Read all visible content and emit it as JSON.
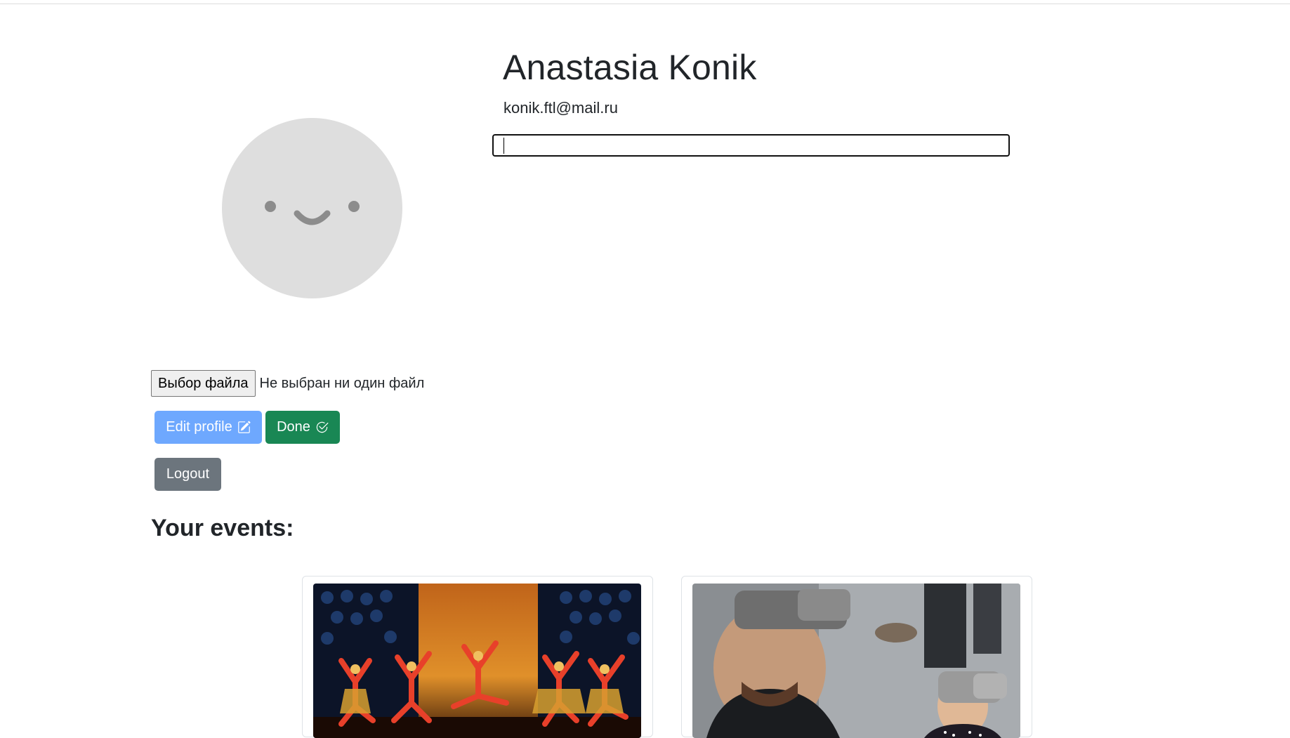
{
  "profile": {
    "name": "Anastasia Konik",
    "email": "konik.ftl@mail.ru",
    "bio_value": "",
    "avatar_icon": "smiley-placeholder-icon"
  },
  "file_input": {
    "button_label": "Выбор файла",
    "status_text": "Не выбран ни один файл"
  },
  "actions": {
    "edit_label": "Edit profile",
    "edit_icon": "pencil-square-icon",
    "done_label": "Done",
    "done_icon": "check-circle-icon",
    "logout_label": "Logout"
  },
  "events": {
    "title": "Your events:",
    "items": [
      {
        "image": "dance-performance-photo"
      },
      {
        "image": "vr-headset-photo"
      }
    ]
  },
  "colors": {
    "edit_button": "#6ea8fe",
    "done_button": "#198754",
    "logout_button": "#6c757d"
  }
}
